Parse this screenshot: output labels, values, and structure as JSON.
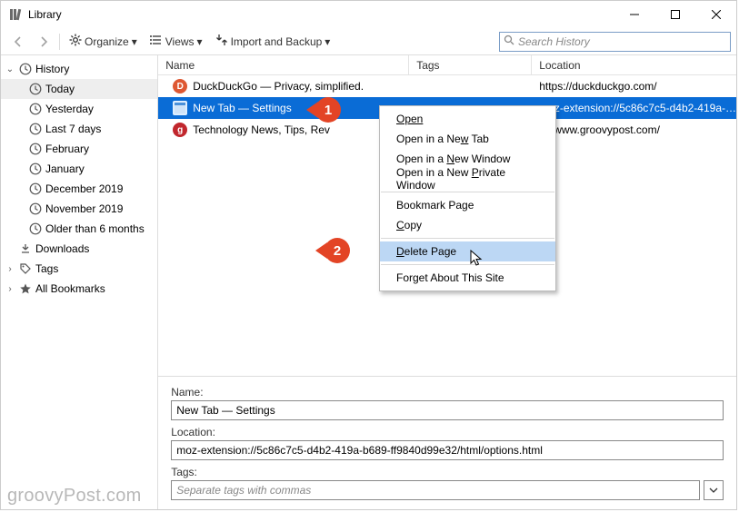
{
  "window": {
    "title": "Library"
  },
  "toolbar": {
    "organize": "Organize",
    "views": "Views",
    "import": "Import and Backup",
    "search_placeholder": "Search History"
  },
  "sidebar": {
    "history": "History",
    "items": [
      "Today",
      "Yesterday",
      "Last 7 days",
      "February",
      "January",
      "December 2019",
      "November 2019",
      "Older than 6 months"
    ],
    "downloads": "Downloads",
    "tags": "Tags",
    "bookmarks": "All Bookmarks"
  },
  "columns": {
    "name": "Name",
    "tags": "Tags",
    "location": "Location"
  },
  "rows": [
    {
      "title": "DuckDuckGo — Privacy, simplified.",
      "loc": "https://duckduckgo.com/",
      "icon": "ddg"
    },
    {
      "title": "New Tab — Settings",
      "loc": "moz-extension://5c86c7c5-d4b2-419a-…",
      "icon": "newtab",
      "selected": true
    },
    {
      "title": "Technology News, Tips, Rev",
      "loc": "s://www.groovypost.com/",
      "icon": "gp"
    }
  ],
  "context": {
    "open": "Open",
    "open_tab_pre": "Open in a Ne",
    "open_tab_u": "w",
    "open_tab_post": " Tab",
    "open_win_pre": "Open in a ",
    "open_win_u": "N",
    "open_win_post": "ew Window",
    "open_priv_pre": "Open in a New ",
    "open_priv_u": "P",
    "open_priv_post": "rivate Window",
    "bookmark": "Bookmark Page",
    "copy_u": "C",
    "copy_post": "opy",
    "delete_u": "D",
    "delete_post": "elete Page",
    "forget": "Forget About This Site"
  },
  "details": {
    "name_label": "Name:",
    "name_value": "New Tab — Settings",
    "location_label": "Location:",
    "location_value": "moz-extension://5c86c7c5-d4b2-419a-b689-ff9840d99e32/html/options.html",
    "tags_label": "Tags:",
    "tags_placeholder": "Separate tags with commas"
  },
  "badges": {
    "b1": "1",
    "b2": "2"
  },
  "watermark": "groovyPost.com"
}
